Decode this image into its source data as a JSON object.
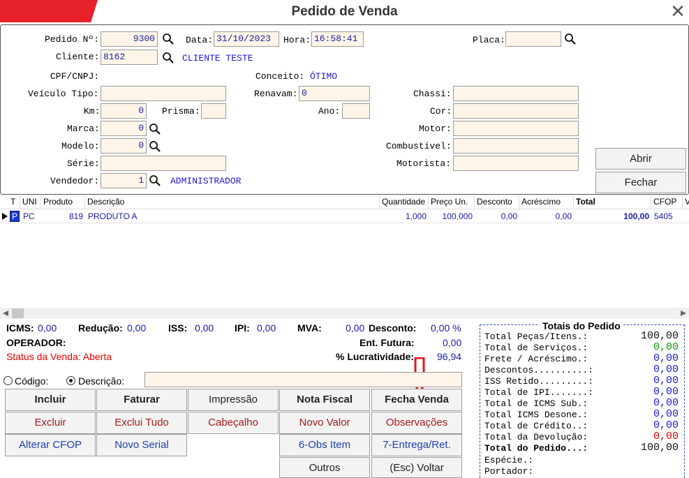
{
  "window": {
    "title": "Pedido de Venda",
    "close": "✕"
  },
  "form": {
    "pedido_label": "Pedido Nº:",
    "pedido_value": "9300",
    "data_label": "Data:",
    "data_value": "31/10/2023",
    "hora_label": "Hora:",
    "hora_value": "16:58:41",
    "placa_label": "Placa:",
    "placa_value": "",
    "cliente_label": "Cliente:",
    "cliente_value": "8162",
    "cliente_name": "CLIENTE TESTE",
    "cpf_label": "CPF/CNPJ:",
    "conceito_label": "Conceito:",
    "conceito_value": "ÓTIMO",
    "veiculo_tipo_label": "Veículo Tipo:",
    "veiculo_tipo_value": "",
    "renavam_label": "Renavam:",
    "renavam_value": "0",
    "chassi_label": "Chassi:",
    "chassi_value": "",
    "km_label": "Km:",
    "km_value": "0",
    "prisma_label": "Prisma:",
    "prisma_value": "",
    "ano_label": "Ano:",
    "ano_value": "",
    "cor_label": "Cor:",
    "cor_value": "",
    "marca_label": "Marca:",
    "marca_value": "0",
    "motor_label": "Motor:",
    "motor_value": "",
    "modelo_label": "Modelo:",
    "modelo_value": "0",
    "combustivel_label": "Combustível:",
    "combustivel_value": "",
    "serie_label": "Série:",
    "serie_value": "",
    "motorista_label": "Motorista:",
    "motorista_value": "",
    "vendedor_label": "Vendedor:",
    "vendedor_value": "1",
    "vendedor_name": "ADMINISTRADOR",
    "abrir": "Abrir",
    "fechar": "Fechar"
  },
  "grid": {
    "headers": {
      "t": "T",
      "uni": "UNI",
      "produto": "Produto",
      "descricao": "Descrição",
      "quantidade": "Quantidade",
      "preco": "Preço Un.",
      "desconto": "Desconto",
      "acrescimo": "Acréscimo",
      "total": "Total",
      "cfop": "CFOP",
      "v": "V"
    },
    "rows": [
      {
        "t": "P",
        "uni": "PC",
        "produto": "819",
        "descricao": "PRODUTO A",
        "quantidade": "1,000",
        "preco": "100,000",
        "desconto": "0,00",
        "acrescimo": "0,00",
        "total": "100,00",
        "cfop": "5405"
      }
    ]
  },
  "summary": {
    "icms_label": "ICMS:",
    "icms_value": "0,00",
    "reducao_label": "Redução:",
    "reducao_value": "0,00",
    "iss_label": "ISS:",
    "iss_value": "0,00",
    "ipi_label": "IPI:",
    "ipi_value": "0,00",
    "mva_label": "MVA:",
    "mva_value": "0,00",
    "desconto_label": "Desconto:",
    "desconto_value": "0,00 %",
    "operador_label": "OPERADOR:",
    "ent_futura_label": "Ent. Futura:",
    "ent_futura_value": "0,00",
    "status": "Status da Venda: Aberta",
    "lucratividade_label": "% Lucratividade:",
    "lucratividade_value": "96,94",
    "codigo_label": "Código:",
    "descricao_label": "Descrição:"
  },
  "buttons": {
    "incluir": "Incluir",
    "faturar": "Faturar",
    "impressao": "Impressão",
    "nota_fiscal": "Nota Fiscal",
    "fecha_venda": "Fecha Venda",
    "excluir": "Excluir",
    "exclui_tudo": "Exclui Tudo",
    "cabecalho": "Cabeçalho",
    "novo_valor": "Novo Valor",
    "observacoes": "Observações",
    "alterar_cfop": "Alterar CFOP",
    "novo_serial": "Novo Serial",
    "obs_item": "6-Obs Item",
    "entrega": "7-Entrega/Ret.",
    "outros": "Outros",
    "voltar": "(Esc) Voltar"
  },
  "totais": {
    "title": "Totais do Pedido",
    "pecas_label": "Total Peças/Itens.:",
    "pecas_value": "100,00",
    "servicos_label": "Total de Serviços.:",
    "servicos_value": "0,00",
    "frete_label": "Frete / Acréscimo.:",
    "frete_value": "0,00",
    "descontos_label": "Descontos..........:",
    "descontos_value": "0,00",
    "iss_label": "ISS Retido.........:",
    "iss_value": "0,00",
    "ipi_label": "Total de IPI.......:",
    "ipi_value": "0,00",
    "icms_sub_label": "Total de ICMS Sub.:",
    "icms_sub_value": "0,00",
    "icms_des_label": "Total ICMS Desone.:",
    "icms_des_value": "0,00",
    "credito_label": "Total de Crédito..:",
    "credito_value": "0,00",
    "devolucao_label": "Total da Devolução:",
    "devolucao_value": "0,00",
    "pedido_label": "Total do Pedido...:",
    "pedido_value": "100,00",
    "especie_label": "Espécie.:",
    "portador_label": "Portador:"
  }
}
